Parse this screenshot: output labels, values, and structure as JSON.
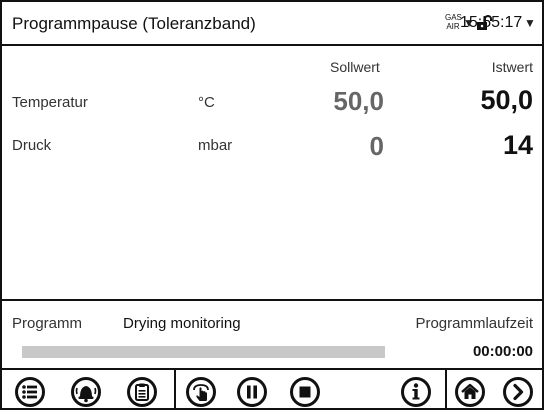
{
  "header": {
    "title": "Programmpause (Toleranzband)",
    "gas_line1": "GAS",
    "gas_line2": "AIR",
    "time": "15:55:17"
  },
  "columns": {
    "setpoint": "Sollwert",
    "actual": "Istwert"
  },
  "rows": [
    {
      "label": "Temperatur",
      "unit": "°C",
      "setpoint": "50,0",
      "actual": "50,0"
    },
    {
      "label": "Druck",
      "unit": "mbar",
      "setpoint": "0",
      "actual": "14"
    }
  ],
  "program": {
    "label": "Programm",
    "name": "Drying monitoring",
    "runtime_label": "Programmlaufzeit",
    "runtime": "00:00:00",
    "progress_fraction": 0.0
  },
  "toolbar": {
    "icons": [
      "menu-icon",
      "alarm-bell-icon",
      "clipboard-icon",
      "touch-hand-icon",
      "pause-icon",
      "stop-icon",
      "info-icon",
      "home-icon",
      "next-icon"
    ]
  },
  "colors": {
    "setpoint_text": "#666666",
    "actual_text": "#111111",
    "progress_track": "#c8c8c8",
    "border": "#111111"
  }
}
